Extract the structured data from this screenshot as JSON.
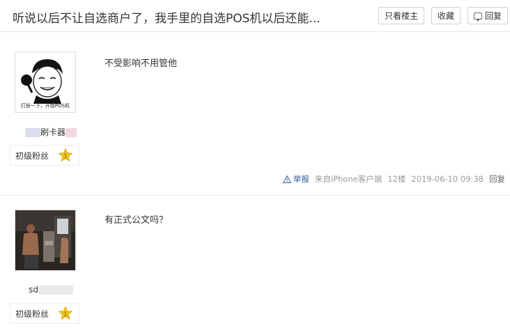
{
  "thread": {
    "title": "听说以后不让自选商户了，我手里的自选POS机以后还能...",
    "buttons": {
      "only_op": "只看楼主",
      "collect": "收藏",
      "reply": "回复"
    }
  },
  "posts": [
    {
      "avatar_caption": "打扮一下，开始POS机",
      "username": "刷卡器",
      "level": "初级粉丝",
      "level_badge": "1",
      "content": "不受影响不用管他",
      "meta": {
        "report": "举报",
        "client": "来自iPhone客户端",
        "floor": "12楼",
        "time": "2019-06-10 09:38",
        "reply": "回复"
      }
    },
    {
      "username": "sd",
      "level": "初级粉丝",
      "level_badge": "1",
      "content": "有正式公文吗？"
    }
  ],
  "colors": {
    "link": "#2e5c9a",
    "star": "#f5c518",
    "border": "#e5e5e5"
  }
}
